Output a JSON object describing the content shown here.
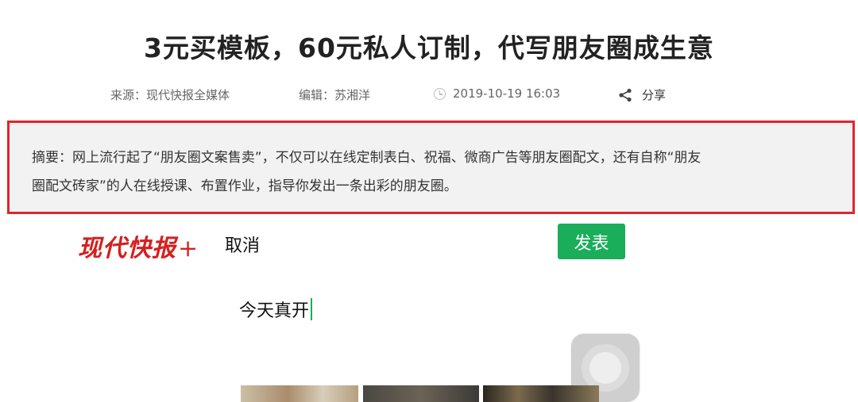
{
  "article": {
    "title": "3元买模板，60元私人订制，代写朋友圈成生意",
    "source": "来源：现代快报全媒体",
    "editor": "编辑：苏湘洋",
    "datetime": "2019-10-19 16:03",
    "share_label": "分享"
  },
  "summary": {
    "line1": "摘要：网上流行起了“朋友圈文案售卖”，不仅可以在线定制表白、祝福、微商广告等朋友圈配文，还有自称“朋友",
    "line2": "圈配文砖家”的人在线授课、布置作业，指导你发出一条出彩的朋友圈。",
    "border_color": "#e0252d"
  },
  "screenshot": {
    "logo_text": "现代快报",
    "logo_plus": "+",
    "cancel_label": "取消",
    "publish_label": "发表",
    "compose_text": "今天真开",
    "publish_color": "#1aad5a"
  },
  "icons": [
    "clock-icon",
    "share-icon",
    "assistive-touch-icon"
  ]
}
